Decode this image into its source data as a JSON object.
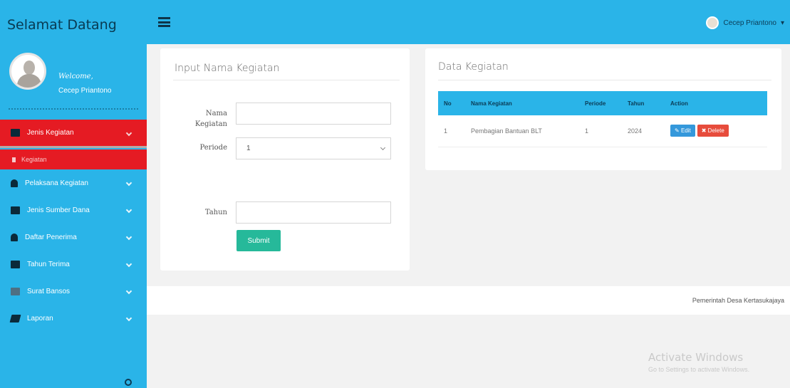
{
  "header": {
    "brand": "Selamat Datang",
    "user_name": "Cecep Priantono"
  },
  "sidebar": {
    "welcome": "Welcome,",
    "user_name": "Cecep Priantono",
    "items": [
      {
        "label": "Jenis Kegiatan",
        "icon": "briefcase-icon"
      },
      {
        "label": "Pelaksana Kegiatan",
        "icon": "user-icon"
      },
      {
        "label": "Jenis Sumber Dana",
        "icon": "money-icon"
      },
      {
        "label": "Daftar Penerima",
        "icon": "user-icon"
      },
      {
        "label": "Tahun Terima",
        "icon": "calendar-icon"
      },
      {
        "label": "Surat Bansos",
        "icon": "table-icon"
      },
      {
        "label": "Laporan",
        "icon": "report-icon"
      }
    ],
    "submenu": "Kegiatan"
  },
  "form": {
    "title": "Input Nama Kegiatan",
    "nama_label": "Nama Kegiatan",
    "nama_value": "",
    "periode_label": "Periode",
    "periode_value": "1",
    "tahun_label": "Tahun",
    "tahun_value": "",
    "submit_label": "Submit"
  },
  "data_panel": {
    "title": "Data Kegiatan",
    "columns": [
      "No",
      "Nama Kegiatan",
      "Periode",
      "Tahun",
      "Action"
    ],
    "rows": [
      {
        "no": "1",
        "nama": "Pembagian Bantuan BLT",
        "periode": "1",
        "tahun": "2024"
      }
    ],
    "edit_label": "Edit",
    "delete_label": "Delete"
  },
  "footer": {
    "text": "Pemerintah Desa Kertasukajaya"
  },
  "watermark": {
    "line1": "Activate Windows",
    "line2": "Go to Settings to activate Windows."
  },
  "colors": {
    "primary": "#2ab4e8",
    "active_menu": "#e51b23",
    "submit": "#26b99a",
    "edit": "#3498db",
    "delete": "#e74c3c"
  }
}
